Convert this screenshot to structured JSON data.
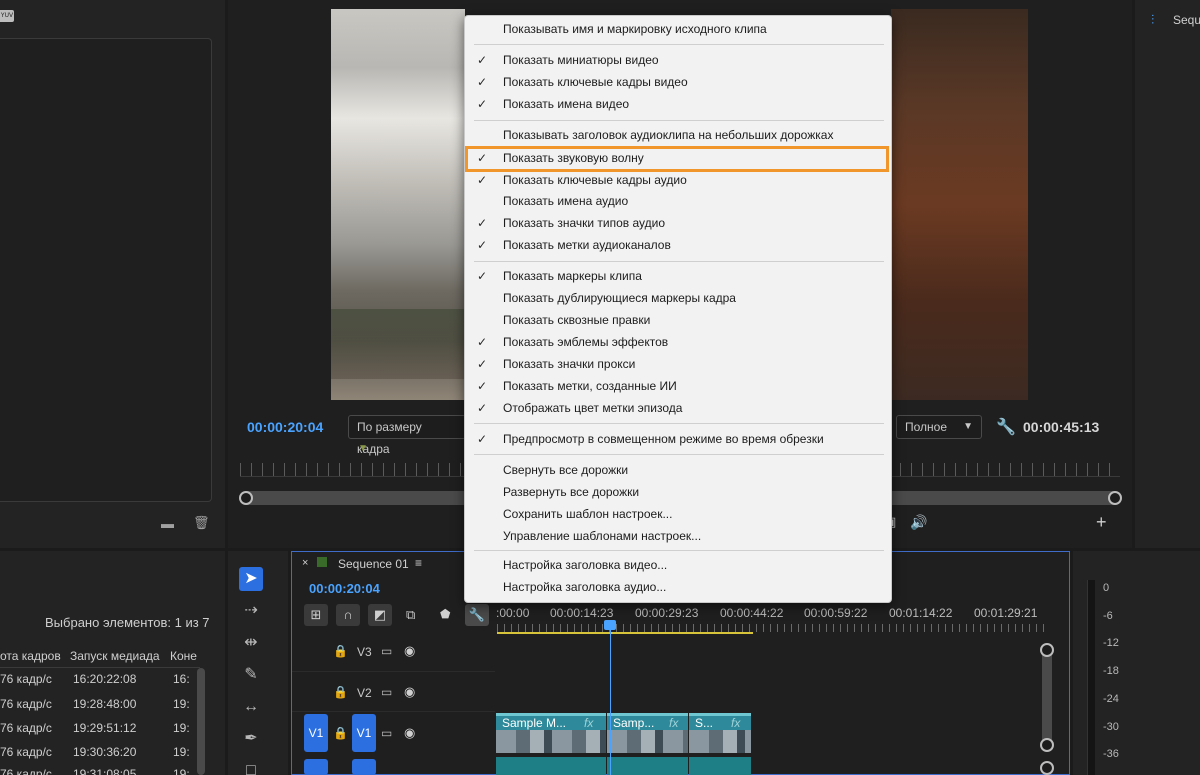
{
  "project_panel": {
    "badge": "YUV",
    "selected_info": "Выбрано элементов: 1 из 7",
    "columns": [
      "ота кадров",
      "Запуск медиада",
      "Коне"
    ],
    "rows": [
      [
        "76 кадр/с",
        "16:20:22:08",
        "16:"
      ],
      [
        "76 кадр/с",
        "19:28:48:00",
        "19:"
      ],
      [
        "76 кадр/с",
        "19:29:51:12",
        "19:"
      ],
      [
        "76 кадр/с",
        "19:30:36:20",
        "19:"
      ],
      [
        "76 кадр/с",
        "19:31:08:05",
        "19:"
      ]
    ]
  },
  "right_panel": {
    "title": "Sequ"
  },
  "program_monitor": {
    "timecode_current": "00:00:20:04",
    "timecode_duration": "00:00:45:13",
    "fit_value": "По размеру кадра",
    "quality_value": "Полное"
  },
  "timeline": {
    "sequence_name": "Sequence 01",
    "timecode": "00:00:20:04",
    "ruler_labels": [
      ":00:00",
      "00:00:14:23",
      "00:00:29:23",
      "00:00:44:22",
      "00:00:59:22",
      "00:01:14:22",
      "00:01:29:21"
    ],
    "tracks": [
      {
        "name": "V3"
      },
      {
        "name": "V2"
      },
      {
        "name": "V1",
        "source": "V1"
      }
    ],
    "clips": [
      {
        "title": "Sample M..."
      },
      {
        "title": "Samp..."
      },
      {
        "title": "S..."
      }
    ],
    "fx_label": "fx"
  },
  "meter": {
    "labels": [
      "0",
      "-6",
      "-12",
      "-18",
      "-24",
      "-30",
      "-36"
    ]
  },
  "context_menu": {
    "items": [
      {
        "label": "Показывать имя и маркировку исходного клипа",
        "checked": false
      },
      {
        "label": "Показать миниатюры видео",
        "checked": true
      },
      {
        "label": "Показать ключевые кадры видео",
        "checked": true
      },
      {
        "label": "Показать имена видео",
        "checked": true
      },
      {
        "label": "Показывать заголовок аудиоклипа на небольших дорожках",
        "checked": false
      },
      {
        "label": "Показать звуковую волну",
        "checked": true
      },
      {
        "label": "Показать ключевые кадры аудио",
        "checked": true
      },
      {
        "label": "Показать имена аудио",
        "checked": false
      },
      {
        "label": "Показать значки типов аудио",
        "checked": true
      },
      {
        "label": "Показать метки аудиоканалов",
        "checked": true
      },
      {
        "label": "Показать маркеры клипа",
        "checked": true
      },
      {
        "label": "Показать дублирующиеся маркеры кадра",
        "checked": false
      },
      {
        "label": "Показать сквозные правки",
        "checked": false
      },
      {
        "label": "Показать эмблемы эффектов",
        "checked": true
      },
      {
        "label": "Показать значки прокси",
        "checked": true
      },
      {
        "label": "Показать метки, созданные ИИ",
        "checked": true
      },
      {
        "label": "Отображать цвет метки эпизода",
        "checked": true
      },
      {
        "label": "Предпросмотр в совмещенном режиме во время обрезки",
        "checked": true
      },
      {
        "label": "Свернуть все дорожки",
        "checked": false
      },
      {
        "label": "Развернуть все дорожки",
        "checked": false
      },
      {
        "label": "Сохранить шаблон настроек...",
        "checked": false
      },
      {
        "label": "Управление шаблонами настроек...",
        "checked": false
      },
      {
        "label": "Настройка заголовка видео...",
        "checked": false
      },
      {
        "label": "Настройка заголовка аудио...",
        "checked": false
      }
    ],
    "check_glyph": "✓",
    "highlighted_index": 5,
    "highlight_color": "#f0962b"
  },
  "icons": {
    "folder": "folder-icon",
    "trash": "trash-icon",
    "wrench": "wrench-icon",
    "volume": "volume-icon",
    "plus": "plus-icon"
  }
}
